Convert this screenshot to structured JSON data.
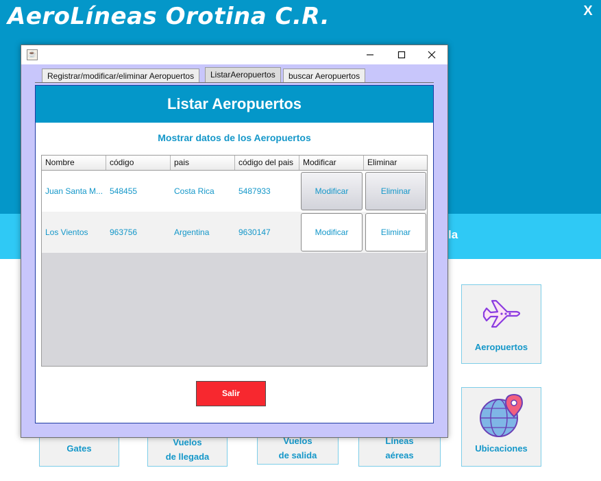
{
  "app": {
    "title": "AeroLíneas Orotina C.R.",
    "close_label": "X",
    "band_fragment": "la"
  },
  "tiles": {
    "aeropuertos": "Aeropuertos",
    "ubicaciones": "Ubicaciones",
    "gates": "Gates",
    "vuelos_llegada_1": "Vuelos",
    "vuelos_llegada_2": "de llegada",
    "vuelos_salida_1": "Vuelos",
    "vuelos_salida_2": "de salida",
    "lineas_1": "Líneas",
    "lineas_2": "aéreas"
  },
  "dialog": {
    "tabs": [
      "Registrar/modificar/eliminar Aeropuertos",
      "ListarAeropuertos",
      "buscar Aeropuertos"
    ],
    "active_tab": "ListarAeropuertos",
    "header": "Listar Aeropuertos",
    "subtitle": "Mostrar datos de los Aeropuertos",
    "table": {
      "columns": [
        "Nombre",
        "código",
        "pais",
        "código del pais",
        "Modificar",
        "Eliminar"
      ],
      "rows": [
        {
          "nombre": "Juan Santa M...",
          "codigo": "548455",
          "pais": "Costa Rica",
          "codigo_pais": "5487933",
          "modificar": "Modificar",
          "eliminar": "Eliminar"
        },
        {
          "nombre": "Los Vientos",
          "codigo": "963756",
          "pais": "Argentina",
          "codigo_pais": "9630147",
          "modificar": "Modificar",
          "eliminar": "Eliminar"
        }
      ]
    },
    "salir_label": "Salir"
  },
  "colors": {
    "brand_blue": "#0497c9",
    "band_cyan": "#2fc9f5",
    "dialog_bg": "#c8c6fb",
    "salir_red": "#f7282f"
  }
}
